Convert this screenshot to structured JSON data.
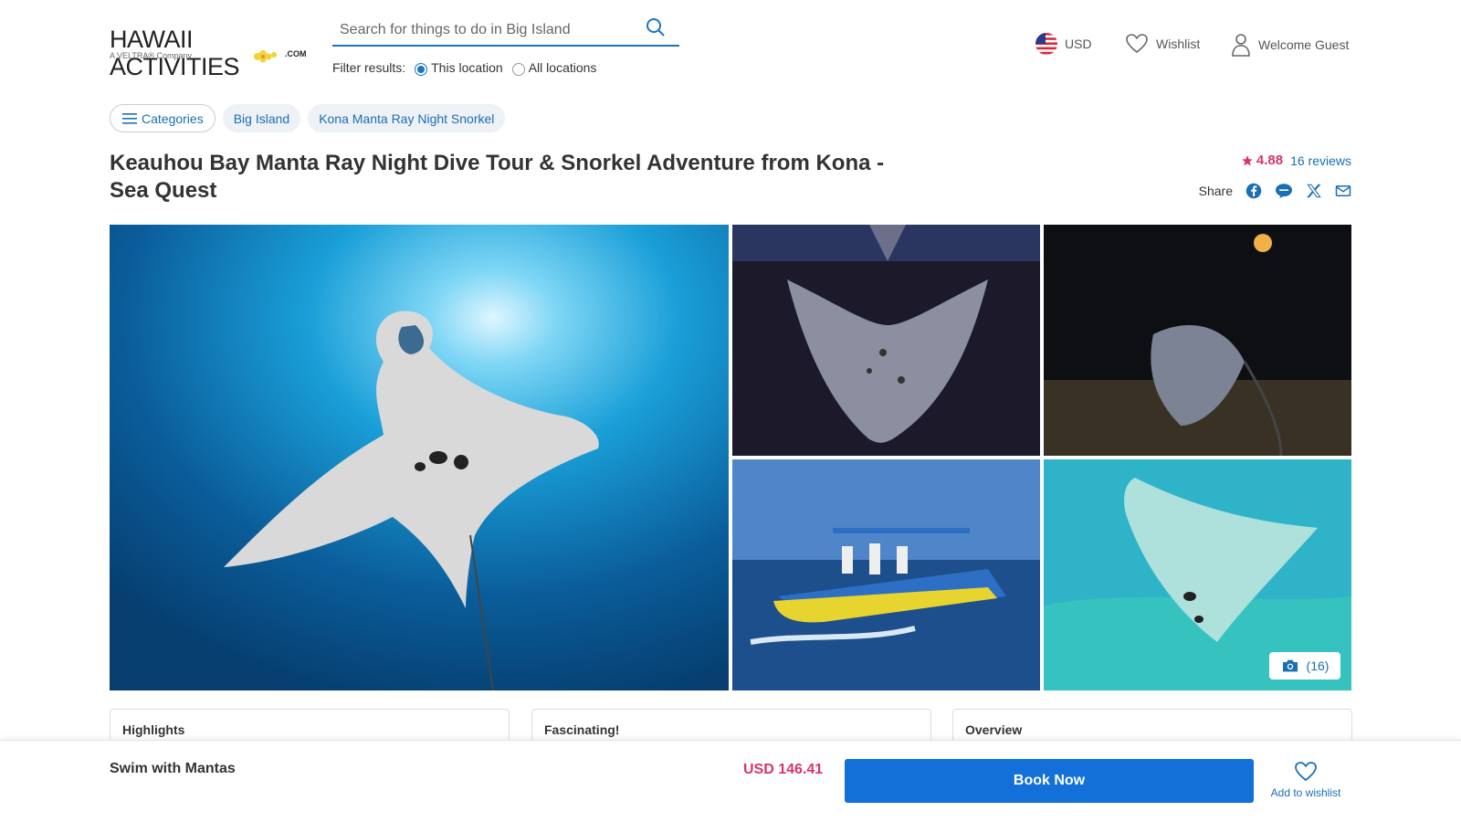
{
  "header": {
    "logo_main": "HAWAII ACTIVITIES",
    "logo_sub": "A VELTRA® Company",
    "logo_com": ".COM",
    "search_placeholder": "Search for things to do in Big Island",
    "filter_label": "Filter results:",
    "filter_options": [
      "This location",
      "All locations"
    ],
    "currency": "USD",
    "wishlist": "Wishlist",
    "welcome": "Welcome Guest"
  },
  "breadcrumb": {
    "categories": "Categories",
    "items": [
      "Big Island",
      "Kona Manta Ray Night Snorkel"
    ]
  },
  "product": {
    "title": "Keauhou Bay Manta Ray Night Dive Tour & Snorkel Adventure from Kona - Sea Quest",
    "rating": "4.88",
    "reviews": "16 reviews",
    "share_label": "Share"
  },
  "gallery": {
    "photo_count": "(16)"
  },
  "cards": [
    "Highlights",
    "Fascinating!",
    "Overview"
  ],
  "bottom_bar": {
    "title": "Swim with Mantas",
    "price": "USD 146.41",
    "book_label": "Book Now",
    "wishlist_label": "Add to wishlist"
  },
  "colors": {
    "accent_blue": "#1370d8",
    "link_blue": "#1a6fb5",
    "price_pink": "#d8356b"
  },
  "icons": [
    "search-icon",
    "us-flag-icon",
    "heart-icon",
    "user-icon",
    "hamburger-icon",
    "star-icon",
    "facebook-icon",
    "line-icon",
    "x-icon",
    "mail-icon",
    "camera-icon"
  ]
}
